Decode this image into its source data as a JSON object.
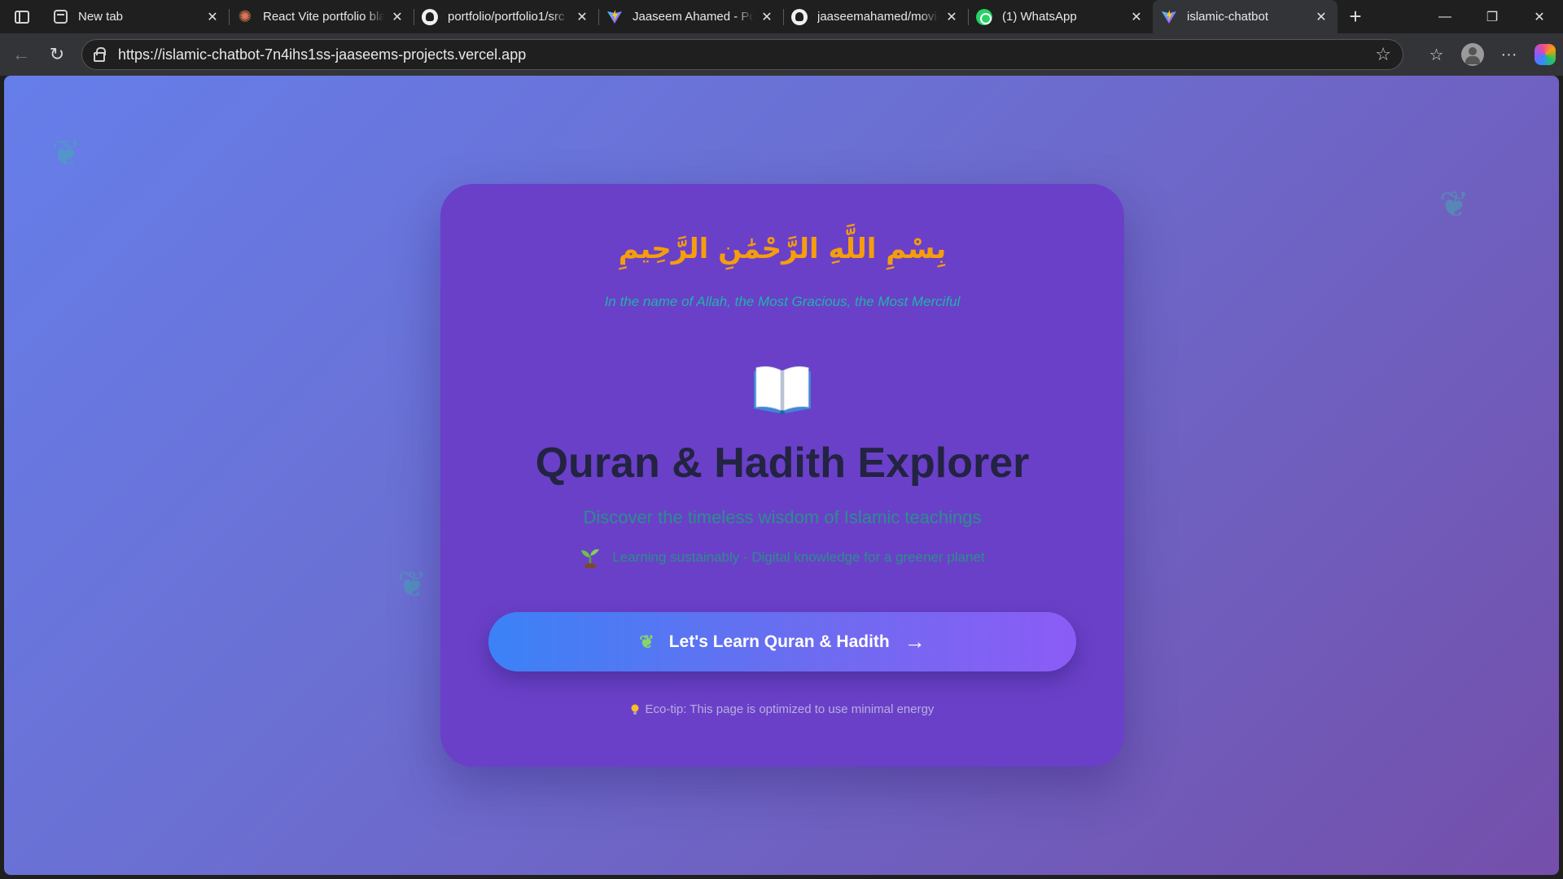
{
  "browser": {
    "tabs": [
      {
        "title": "New tab",
        "favicon": "new-tab-icon"
      },
      {
        "title": "React Vite portfolio blank",
        "favicon": "claude-icon"
      },
      {
        "title": "portfolio/portfolio1/src",
        "favicon": "github-icon"
      },
      {
        "title": "Jaaseem Ahamed - Portfolio",
        "favicon": "vite-icon"
      },
      {
        "title": "jaaseemahamed/movie",
        "favicon": "github-icon"
      },
      {
        "title": "(1) WhatsApp",
        "favicon": "whatsapp-icon"
      },
      {
        "title": "islamic-chatbot",
        "favicon": "vite-icon",
        "active": true
      }
    ],
    "url": "https://islamic-chatbot-7n4ihs1ss-jaaseems-projects.vercel.app"
  },
  "page": {
    "bismillah": "بِسْمِ اللَّهِ الرَّحْمَٰنِ الرَّحِيمِ",
    "translation": "In the name of Allah, the Most Gracious, the Most Merciful",
    "book_icon": "open-book-icon",
    "title": "Quran & Hadith Explorer",
    "subtitle": "Discover the timeless wisdom of Islamic teachings",
    "eco_line": "Learning sustainably - Digital knowledge for a greener planet",
    "cta_label": "Let's Learn Quran & Hadith",
    "cta_arrow": "→",
    "eco_tip": "Eco-tip: This page is optimized to use minimal energy"
  },
  "colors": {
    "background_start": "#667eea",
    "background_end": "#744fab",
    "card": "#6a40c8",
    "arabic": "#f59e0b",
    "translation": "#20b2aa",
    "title": "#232342",
    "button_start": "#3b82f6",
    "button_end": "#8b5cf6"
  }
}
